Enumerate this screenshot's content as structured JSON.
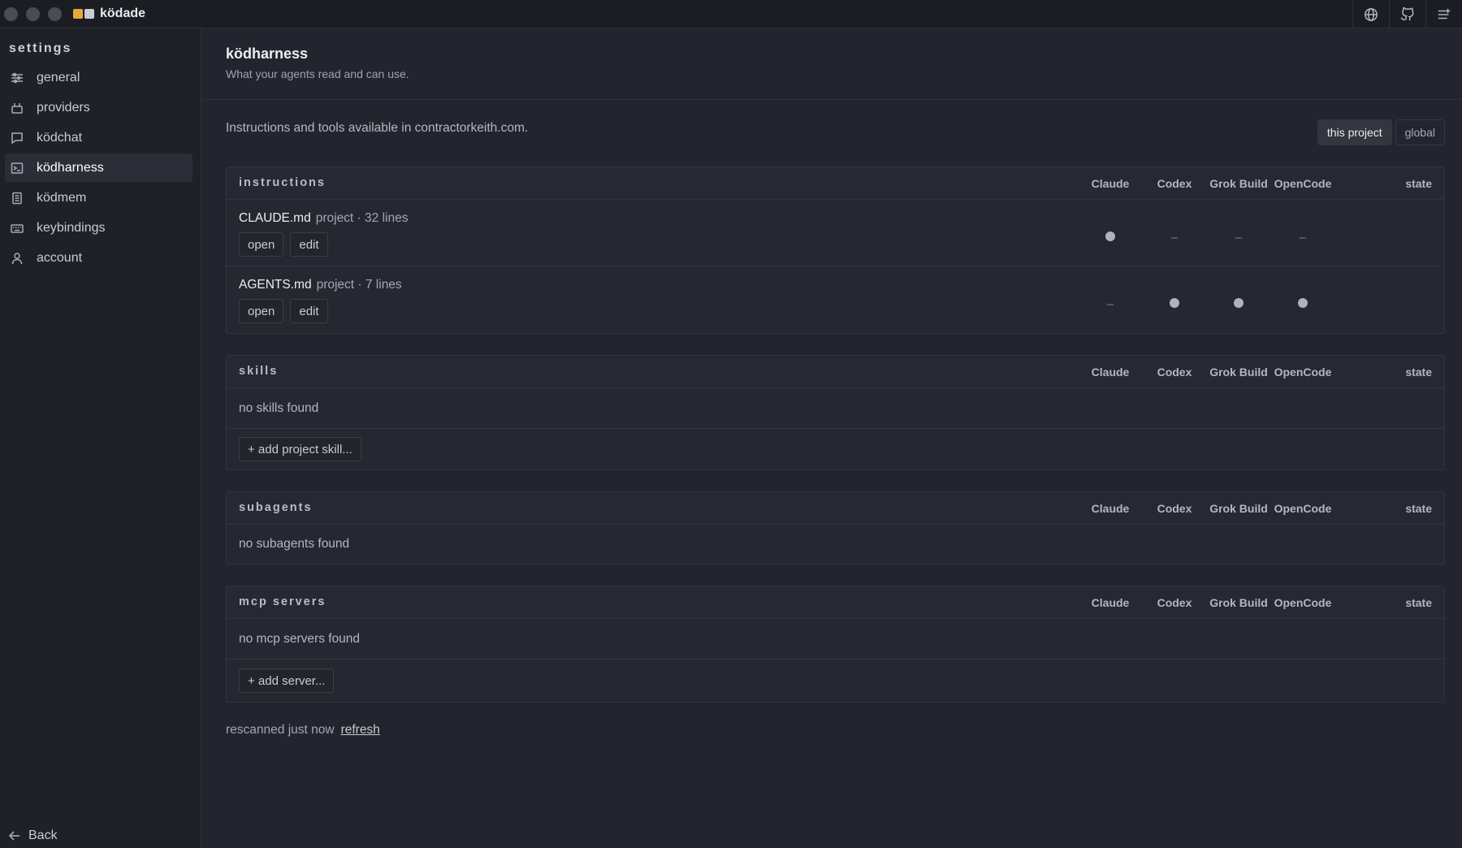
{
  "app": {
    "title": "ködade"
  },
  "titlebar": {
    "icons": [
      "globe-icon",
      "github-icon",
      "menu-plus-icon"
    ]
  },
  "sidebar": {
    "title": "settings",
    "items": [
      {
        "label": "general",
        "icon": "sliders-icon",
        "active": false
      },
      {
        "label": "providers",
        "icon": "plug-icon",
        "active": false
      },
      {
        "label": "ködchat",
        "icon": "chat-icon",
        "active": false
      },
      {
        "label": "ködharness",
        "icon": "terminal-icon",
        "active": true
      },
      {
        "label": "ködmem",
        "icon": "book-icon",
        "active": false
      },
      {
        "label": "keybindings",
        "icon": "keyboard-icon",
        "active": false
      },
      {
        "label": "account",
        "icon": "user-icon",
        "active": false
      }
    ],
    "back_label": "Back"
  },
  "header": {
    "title": "ködharness",
    "subtitle": "What your agents read and can use."
  },
  "scope": {
    "description": "Instructions and tools available in contractorkeith.com.",
    "options": [
      "this project",
      "global"
    ],
    "selected": "this project"
  },
  "columns": [
    "Claude",
    "Codex",
    "Grok Build",
    "OpenCode"
  ],
  "state_label": "state",
  "sections": {
    "instructions": {
      "title": "instructions",
      "rows": [
        {
          "name": "CLAUDE.md",
          "meta": "project · 32 lines",
          "open_label": "open",
          "edit_label": "edit",
          "support": [
            true,
            false,
            false,
            false
          ]
        },
        {
          "name": "AGENTS.md",
          "meta": "project · 7 lines",
          "open_label": "open",
          "edit_label": "edit",
          "support": [
            false,
            true,
            true,
            true
          ]
        }
      ]
    },
    "skills": {
      "title": "skills",
      "empty": "no skills found",
      "add_label": "+ add project skill..."
    },
    "subagents": {
      "title": "subagents",
      "empty": "no subagents found"
    },
    "mcp": {
      "title": "mcp servers",
      "empty": "no mcp servers found",
      "add_label": "+ add server..."
    }
  },
  "footer": {
    "status": "rescanned just now",
    "refresh_label": "refresh"
  },
  "dash": "–"
}
